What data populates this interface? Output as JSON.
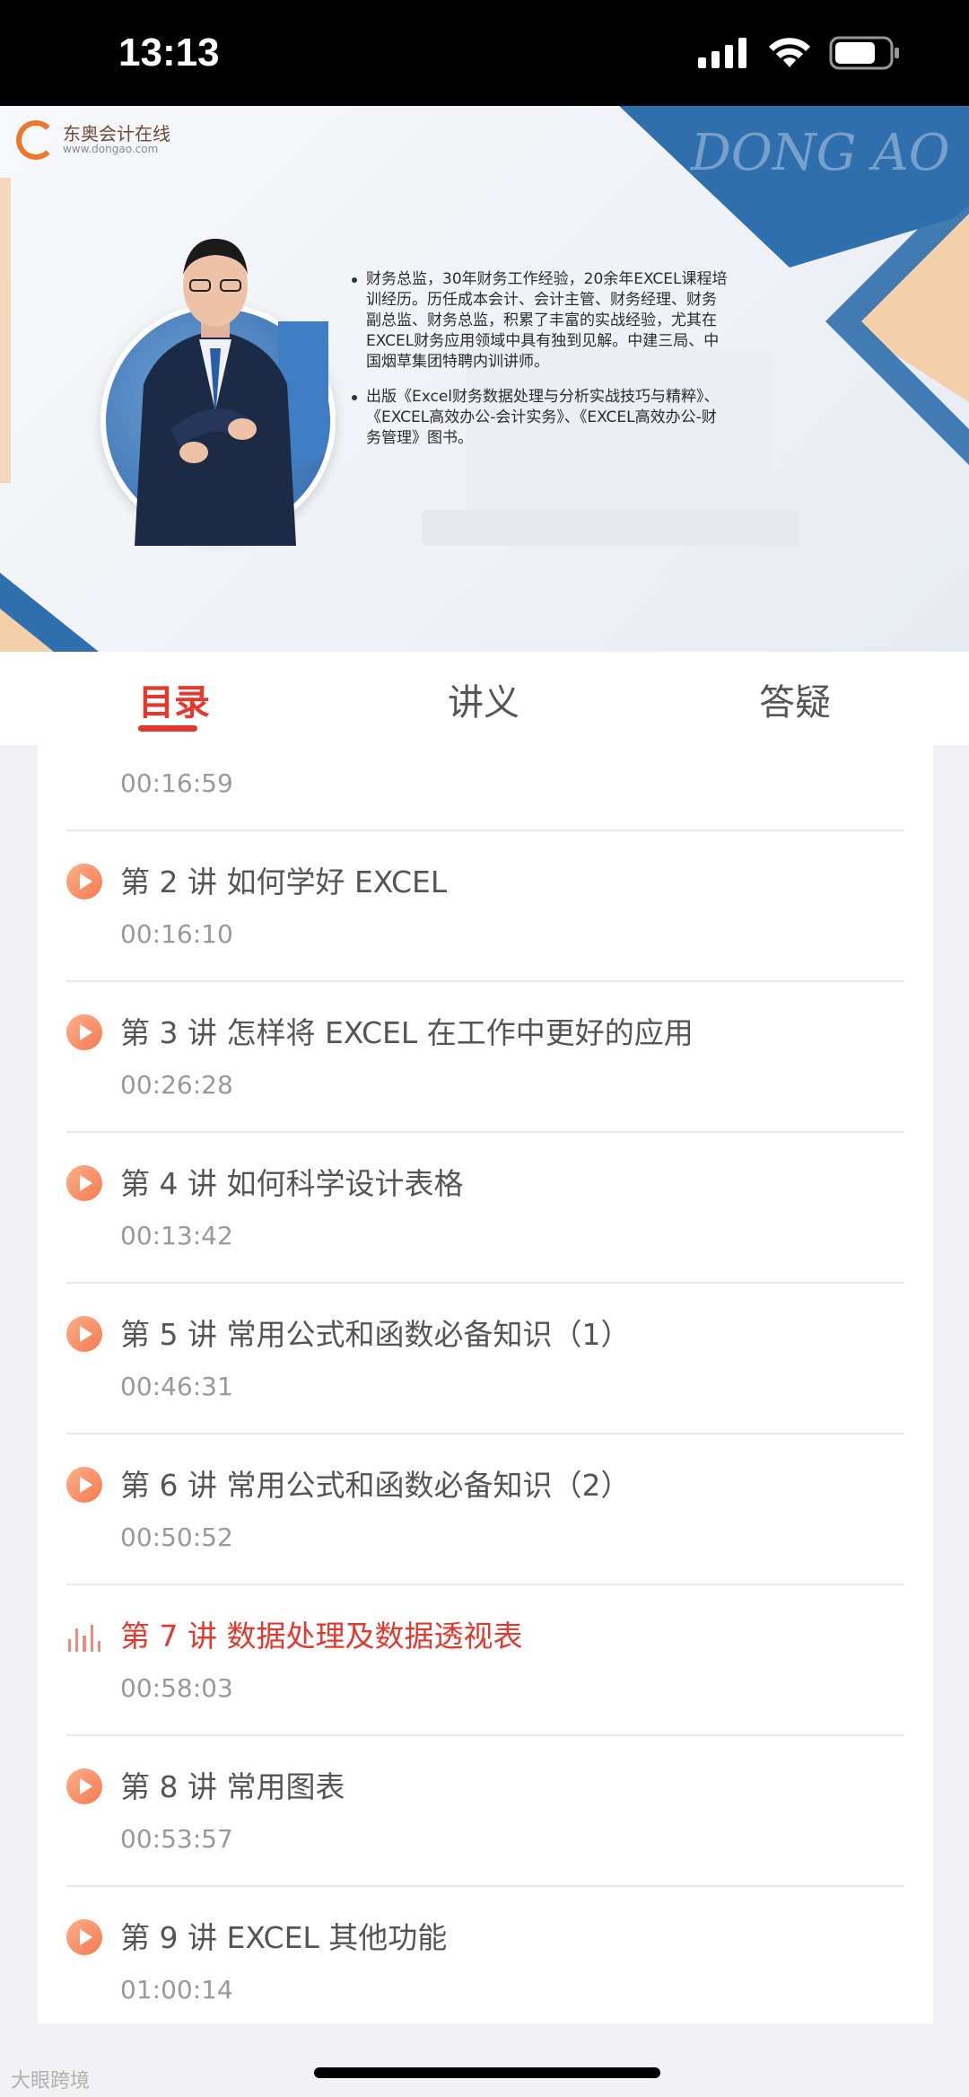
{
  "status_bar": {
    "time": "13:13"
  },
  "video": {
    "logo_text": "东奥会计在线",
    "logo_sub": "www.dongao.com",
    "watermark": "DONG AO",
    "bullets": [
      "财务总监，30年财务工作经验，20余年EXCEL课程培训经历。历任成本会计、会计主管、财务经理、财务副总监、财务总监，积累了丰富的实战经验，尤其在EXCEL财务应用领域中具有独到见解。中建三局、中国烟草集团特聘内训讲师。",
      "出版《Excel财务数据处理与分析实战技巧与精粹》、《EXCEL高效办公-会计实务》、《EXCEL高效办公-财务管理》图书。"
    ]
  },
  "tabs": [
    {
      "label": "目录",
      "active": true
    },
    {
      "label": "讲义",
      "active": false
    },
    {
      "label": "答疑",
      "active": false
    }
  ],
  "lessons": {
    "partial": {
      "time": "00:16:59"
    },
    "items": [
      {
        "title": "第 2 讲 如何学好 EXCEL",
        "time": "00:16:10",
        "playing": false
      },
      {
        "title": "第 3 讲 怎样将 EXCEL 在工作中更好的应用",
        "time": "00:26:28",
        "playing": false
      },
      {
        "title": "第 4 讲 如何科学设计表格",
        "time": "00:13:42",
        "playing": false
      },
      {
        "title": "第 5 讲 常用公式和函数必备知识（1）",
        "time": "00:46:31",
        "playing": false
      },
      {
        "title": "第 6 讲 常用公式和函数必备知识（2）",
        "time": "00:50:52",
        "playing": false
      },
      {
        "title": "第 7 讲 数据处理及数据透视表",
        "time": "00:58:03",
        "playing": true
      },
      {
        "title": "第 8 讲 常用图表",
        "time": "00:53:57",
        "playing": false
      },
      {
        "title": "第 9 讲 EXCEL 其他功能",
        "time": "01:00:14",
        "playing": false
      }
    ]
  },
  "corner_watermark": "大眼跨境",
  "colors": {
    "accent": "#e2382e",
    "play_icon": "#f4784f"
  }
}
